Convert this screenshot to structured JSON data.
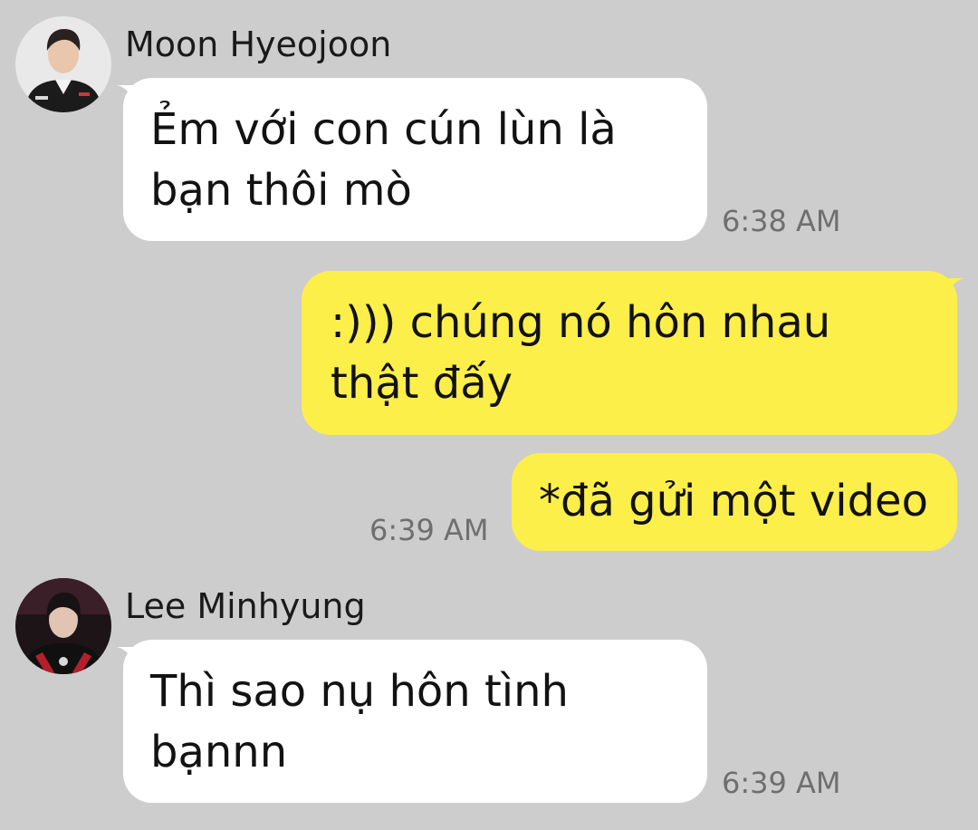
{
  "messages": [
    {
      "sender": "Moon Hyeojoon",
      "avatar_icon": "profile-photo-icon",
      "text": "Ẻm với con cún lùn là bạn thôi mò",
      "time": "6:38 AM",
      "direction": "received"
    },
    {
      "text": ":))) chúng nó hôn nhau thật đấy",
      "direction": "sent"
    },
    {
      "text": "*đã gửi một video",
      "time": "6:39 AM",
      "direction": "sent"
    },
    {
      "sender": "Lee Minhyung",
      "avatar_icon": "profile-photo-icon",
      "text": "Thì sao nụ hôn tình bạnnn",
      "time": "6:39 AM",
      "direction": "received"
    }
  ],
  "colors": {
    "background": "#cdcdcd",
    "received_bubble": "#ffffff",
    "sent_bubble": "#fdef4a",
    "timestamp": "#6f6f6f"
  }
}
